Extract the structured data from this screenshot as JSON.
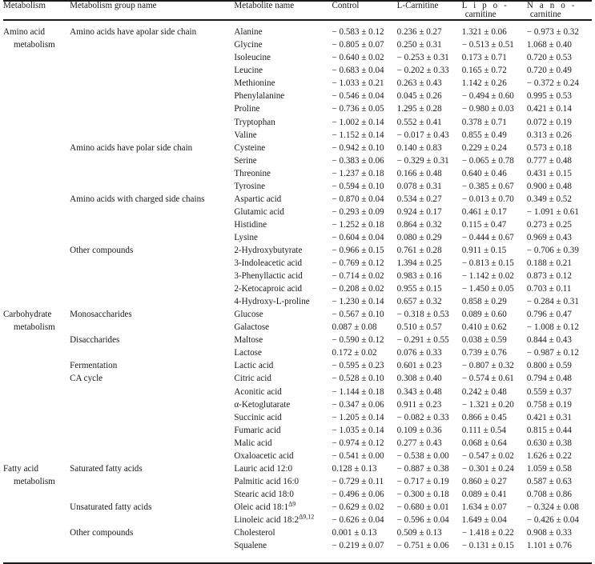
{
  "table": {
    "headers": {
      "metabolism": "Metabolism",
      "group": "Metabolism group name",
      "metabolite": "Metabolite name",
      "control": "Control",
      "l_carnitine_prefix": "L",
      "l_carnitine_rest": "-Carnitine",
      "lipo_line1": "L i p o -",
      "lipo_line2": "carnitine",
      "nano_line1": "N a n o -",
      "nano_line2": "carnitine"
    },
    "sections": [
      {
        "metabolism_line1": "Amino acid",
        "metabolism_line2": "metabolism",
        "groups": [
          {
            "name": "Amino acids have apolar side chain",
            "rows": [
              {
                "metabolite": "Alanine",
                "control": "− 0.583 ± 0.12",
                "l_carnitine": "0.236 ± 0.27",
                "lipo": "1.321 ± 0.06",
                "nano": "− 0.973 ± 0.32"
              },
              {
                "metabolite": "Glycine",
                "control": "− 0.805 ± 0.07",
                "l_carnitine": "0.250 ± 0.31",
                "lipo": "− 0.513 ± 0.51",
                "nano": "1.068 ± 0.40"
              },
              {
                "metabolite": "Isoleucine",
                "control": "− 0.640 ± 0.02",
                "l_carnitine": "− 0.253 ± 0.31",
                "lipo": "0.173 ± 0.71",
                "nano": "0.720 ± 0.53"
              },
              {
                "metabolite": "Leucine",
                "control": "− 0.683 ± 0.04",
                "l_carnitine": "− 0.202 ± 0.33",
                "lipo": "0.165 ± 0.72",
                "nano": "0.720 ± 0.49"
              },
              {
                "metabolite": "Methionine",
                "control": "− 1.033 ± 0.21",
                "l_carnitine": "0.263 ± 0.43",
                "lipo": "1.142 ± 0.26",
                "nano": "− 0.372 ± 0.24"
              },
              {
                "metabolite": "Phenylalanine",
                "control": "− 0.546 ± 0.04",
                "l_carnitine": "0.045 ± 0.26",
                "lipo": "− 0.494 ± 0.60",
                "nano": "0.995 ± 0.53"
              },
              {
                "metabolite": "Proline",
                "control": "− 0.736 ± 0.05",
                "l_carnitine": "1.295 ± 0.28",
                "lipo": "− 0.980 ± 0.03",
                "nano": "0.421 ± 0.14"
              },
              {
                "metabolite": "Tryptophan",
                "control": "− 1.002 ± 0.14",
                "l_carnitine": "0.552 ± 0.41",
                "lipo": "0.378 ± 0.71",
                "nano": "0.072 ± 0.19"
              },
              {
                "metabolite": "Valine",
                "control": "− 1.152 ± 0.14",
                "l_carnitine": "− 0.017 ± 0.43",
                "lipo": "0.855 ± 0.49",
                "nano": "0.313 ± 0.26"
              }
            ]
          },
          {
            "name": "Amino acids have polar side chain",
            "rows": [
              {
                "metabolite": "Cysteine",
                "control": "− 0.942 ± 0.10",
                "l_carnitine": "0.140 ± 0.83",
                "lipo": "0.229 ± 0.24",
                "nano": "0.573 ± 0.18"
              },
              {
                "metabolite": "Serine",
                "control": "− 0.383 ± 0.06",
                "l_carnitine": "− 0.329 ± 0.31",
                "lipo": "− 0.065 ± 0.78",
                "nano": "0.777 ± 0.48"
              },
              {
                "metabolite": "Threonine",
                "control": "− 1.237 ± 0.18",
                "l_carnitine": "0.166 ± 0.48",
                "lipo": "0.640 ± 0.46",
                "nano": "0.431 ± 0.15"
              },
              {
                "metabolite": "Tyrosine",
                "control": "− 0.594 ± 0.10",
                "l_carnitine": "0.078 ± 0.31",
                "lipo": "− 0.385 ± 0.67",
                "nano": "0.900 ± 0.48"
              }
            ]
          },
          {
            "name": "Amino acids with charged side chains",
            "rows": [
              {
                "metabolite": "Aspartic acid",
                "control": "− 0.870 ± 0.04",
                "l_carnitine": "0.534 ± 0.27",
                "lipo": "− 0.013 ± 0.70",
                "nano": "0.349 ± 0.52"
              },
              {
                "metabolite": "Glutamic acid",
                "control": "− 0.293 ± 0.09",
                "l_carnitine": "0.924 ± 0.17",
                "lipo": "0.461 ± 0.17",
                "nano": "− 1.091 ± 0.61"
              },
              {
                "metabolite": "Histidine",
                "control": "− 1.252 ± 0.18",
                "l_carnitine": "0.864 ± 0.32",
                "lipo": "0.115 ± 0.47",
                "nano": "0.273 ± 0.25"
              },
              {
                "metabolite": "Lysine",
                "control": "− 0.604 ± 0.04",
                "l_carnitine": "0.080 ± 0.29",
                "lipo": "− 0.444 ± 0.67",
                "nano": "0.969 ± 0.43"
              }
            ]
          },
          {
            "name": "Other compounds",
            "rows": [
              {
                "metabolite": "2-Hydroxybutyrate",
                "control": "− 0.966 ± 0.15",
                "l_carnitine": "0.761 ± 0.28",
                "lipo": "0.911 ± 0.15",
                "nano": "− 0.706 ± 0.39"
              },
              {
                "metabolite": "3-Indoleacetic acid",
                "control": "− 0.769 ± 0.12",
                "l_carnitine": "1.394 ± 0.25",
                "lipo": "− 0.813 ± 0.15",
                "nano": "0.188 ± 0.21"
              },
              {
                "metabolite": "3-Phenyllactic acid",
                "control": "− 0.714 ± 0.02",
                "l_carnitine": "0.983 ± 0.16",
                "lipo": "− 1.142 ± 0.02",
                "nano": "0.873 ± 0.12"
              },
              {
                "metabolite": "2-Ketocaproic acid",
                "control": "− 0.208 ± 0.02",
                "l_carnitine": "0.955 ± 0.15",
                "lipo": "− 1.450 ± 0.05",
                "nano": "0.703 ± 0.11"
              },
              {
                "metabolite_html": "4-Hydroxy-<span class=\"sc\">L</span>-proline",
                "metabolite": "4-Hydroxy-L-proline",
                "control": "− 1.230 ± 0.14",
                "l_carnitine": "0.657 ± 0.32",
                "lipo": "0.858 ± 0.29",
                "nano": "− 0.284 ± 0.31"
              }
            ]
          }
        ]
      },
      {
        "metabolism_line1": "Carbohydrate",
        "metabolism_line2": "metabolism",
        "groups": [
          {
            "name": "Monosaccharides",
            "rows": [
              {
                "metabolite": "Glucose",
                "control": "− 0.567 ± 0.10",
                "l_carnitine": "− 0.318 ± 0.53",
                "lipo": "0.089 ± 0.60",
                "nano": "0.796 ± 0.47"
              },
              {
                "metabolite": "Galactose",
                "control": "0.087 ± 0.08",
                "l_carnitine": "0.510 ± 0.57",
                "lipo": "0.410 ± 0.62",
                "nano": "− 1.008 ± 0.12"
              }
            ]
          },
          {
            "name": "Disaccharides",
            "rows": [
              {
                "metabolite": "Maltose",
                "control": "− 0.590 ± 0.12",
                "l_carnitine": "− 0.291 ± 0.55",
                "lipo": "0.038 ± 0.59",
                "nano": "0.844 ± 0.43"
              },
              {
                "metabolite": "Lactose",
                "control": "0.172 ± 0.02",
                "l_carnitine": "0.076 ± 0.33",
                "lipo": "0.739 ± 0.76",
                "nano": "− 0.987 ± 0.12"
              }
            ]
          },
          {
            "name": "Fermentation",
            "rows": [
              {
                "metabolite": "Lactic acid",
                "control": "− 0.595 ± 0.23",
                "l_carnitine": "0.601 ± 0.23",
                "lipo": "− 0.807 ± 0.32",
                "nano": "0.800 ± 0.59"
              }
            ]
          },
          {
            "name": "CA cycle",
            "rows": [
              {
                "metabolite": "Citric acid",
                "control": "− 0.528 ± 0.10",
                "l_carnitine": "0.308 ± 0.40",
                "lipo": "− 0.574 ± 0.61",
                "nano": "0.794 ± 0.48"
              },
              {
                "metabolite": "Aconitic acid",
                "control": "− 1.144 ± 0.18",
                "l_carnitine": "0.343 ± 0.48",
                "lipo": "0.242 ± 0.48",
                "nano": "0.559 ± 0.37"
              },
              {
                "metabolite": "α-Ketoglutarate",
                "control": "− 0.347 ± 0.06",
                "l_carnitine": "0.911 ± 0.23",
                "lipo": "− 1.321 ± 0.20",
                "nano": "0.758 ± 0.19"
              },
              {
                "metabolite": "Succinic acid",
                "control": "− 1.205 ± 0.14",
                "l_carnitine": "− 0.082 ± 0.33",
                "lipo": "0.866 ± 0.45",
                "nano": "0.421 ± 0.31"
              },
              {
                "metabolite": "Fumaric acid",
                "control": "− 1.035 ± 0.14",
                "l_carnitine": "0.109 ± 0.36",
                "lipo": "0.111 ± 0.54",
                "nano": "0.815 ± 0.44"
              },
              {
                "metabolite": "Malic acid",
                "control": "− 0.974 ± 0.12",
                "l_carnitine": "0.277 ± 0.43",
                "lipo": "0.068 ± 0.64",
                "nano": "0.630 ± 0.38"
              },
              {
                "metabolite": "Oxaloacetic acid",
                "control": "− 0.541 ± 0.00",
                "l_carnitine": "− 0.538 ± 0.00",
                "lipo": "− 0.547 ± 0.02",
                "nano": "1.626 ± 0.22"
              }
            ]
          }
        ]
      },
      {
        "metabolism_line1": "Fatty acid",
        "metabolism_line2": "metabolism",
        "groups": [
          {
            "name": "Saturated fatty acids",
            "rows": [
              {
                "metabolite": "Lauric acid 12:0",
                "control": "0.128 ± 0.13",
                "l_carnitine": "− 0.887 ± 0.38",
                "lipo": "− 0.301 ± 0.24",
                "nano": "1.059 ± 0.58"
              },
              {
                "metabolite": "Palmitic acid 16:0",
                "control": "− 0.729 ± 0.11",
                "l_carnitine": "− 0.717 ± 0.19",
                "lipo": "0.860 ± 0.27",
                "nano": "0.587 ± 0.63"
              },
              {
                "metabolite": "Stearic acid 18:0",
                "control": "− 0.496 ± 0.06",
                "l_carnitine": "− 0.300 ± 0.18",
                "lipo": "0.089 ± 0.41",
                "nano": "0.708 ± 0.86"
              }
            ]
          },
          {
            "name": "Unsaturated fatty acids",
            "rows": [
              {
                "metabolite_html": "Oleic acid 18:1<sup>Δ9</sup>",
                "metabolite": "Oleic acid 18:1Δ9",
                "control": "− 0.629 ± 0.02",
                "l_carnitine": "− 0.680 ± 0.01",
                "lipo": "1.634 ± 0.07",
                "nano": "− 0.324 ± 0.08"
              },
              {
                "metabolite_html": "Linoleic acid 18:2<sup>Δ9,12</sup>",
                "metabolite": "Linoleic acid 18:2Δ9,12",
                "control": "− 0.626 ± 0.04",
                "l_carnitine": "− 0.596 ± 0.04",
                "lipo": "1.649 ± 0.04",
                "nano": "− 0.426 ± 0.04"
              }
            ]
          },
          {
            "name": "Other compounds",
            "rows": [
              {
                "metabolite": "Cholesterol",
                "control": "0.001 ± 0.13",
                "l_carnitine": "0.509 ± 0.13",
                "lipo": "− 1.418 ± 0.22",
                "nano": "0.908 ± 0.33"
              },
              {
                "metabolite": "Squalene",
                "control": "− 0.219 ± 0.07",
                "l_carnitine": "− 0.751 ± 0.06",
                "lipo": "− 0.131 ± 0.15",
                "nano": "1.101 ± 0.76"
              }
            ]
          }
        ]
      }
    ]
  }
}
